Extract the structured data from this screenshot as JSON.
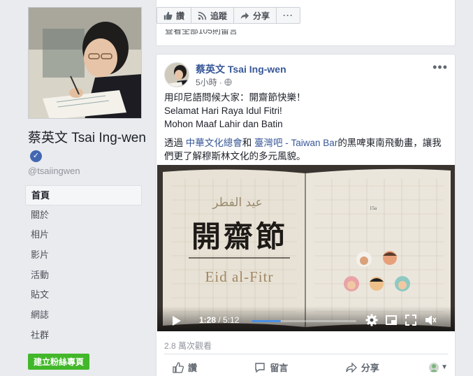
{
  "sidebar": {
    "page_name": "蔡英文 Tsai Ing-wen",
    "handle": "@tsaiingwen",
    "nav": [
      {
        "label": "首頁",
        "active": true
      },
      {
        "label": "關於"
      },
      {
        "label": "相片"
      },
      {
        "label": "影片"
      },
      {
        "label": "活動"
      },
      {
        "label": "貼文"
      },
      {
        "label": "網誌"
      },
      {
        "label": "社群"
      }
    ],
    "create_page_label": "建立粉絲專頁"
  },
  "top_actions": {
    "like_label": "讚",
    "follow_label": "追蹤",
    "share_label": "分享",
    "more_label": "···",
    "view_all_comments": "查看全部105則留言"
  },
  "post": {
    "author": "蔡英文 Tsai Ing-wen",
    "time": "5小時",
    "privacy_icon": "globe-icon",
    "text_lines": [
      "用印尼語問候大家：開齋節快樂！",
      "Selamat Hari Raya Idul Fitri!",
      "Mohon Maaf Lahir dan Batin"
    ],
    "text_p2_prefix": "透過 ",
    "link1": "中華文化總會",
    "text_p2_mid": "和 ",
    "link2": "臺灣吧 - Taiwan Bar",
    "text_p2_suffix": "的黑啤東南飛動畫，讓我們更了解穆斯林文化的多元風貌。",
    "video": {
      "arabic_title": "عيد الفطر",
      "chinese_title": "開齋節",
      "english_title": "Eid al-Fitr",
      "page_mark": "15a",
      "current_time": "1:28",
      "duration": "5:12",
      "progress": 0.28
    },
    "views": "2.8 萬次觀看",
    "actions": {
      "like": "讚",
      "comment": "留言",
      "share": "分享"
    }
  },
  "colors": {
    "link": "#385898",
    "verified": "#4267b2",
    "create_button": "#42b72a",
    "progress": "#4a90e2"
  }
}
